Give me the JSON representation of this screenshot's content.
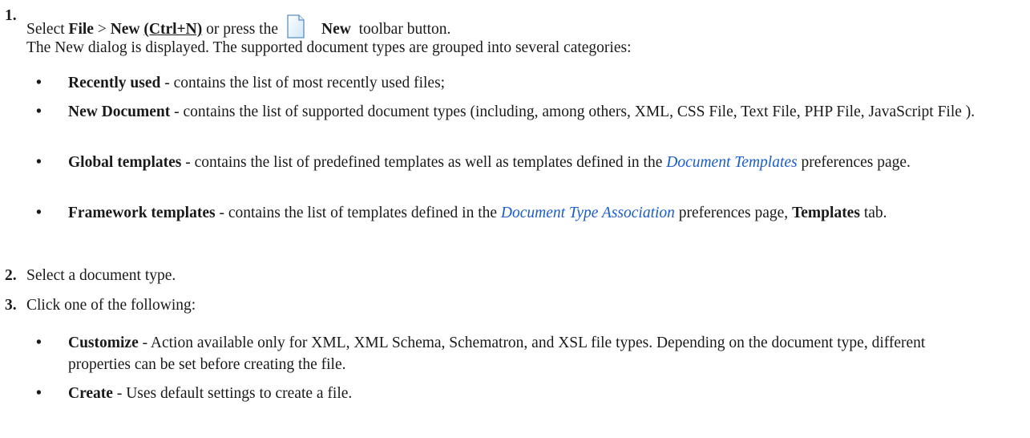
{
  "steps": [
    {
      "num": "1.",
      "intro": {
        "select": "Select ",
        "file": "File",
        "gt": " > ",
        "new": "New",
        "shortcut": "(Ctrl+N)",
        "or_press": " or press the",
        "new_button": "New",
        "toolbar": "  toolbar button."
      },
      "description": "The New dialog is displayed. The supported document types are grouped into several categories:",
      "bullets": [
        {
          "term": "Recently used",
          "text": " - contains the list of most recently used files;"
        },
        {
          "term": "New Document",
          "text": " - contains the list of supported document types (including, among others, XML, CSS File, Text File, PHP File, JavaScript File )."
        },
        {
          "term": "Global templates",
          "text": " - contains the list of predefined templates as well as templates defined in the ",
          "link": "Document Templates",
          "after": " preferences page."
        },
        {
          "term": "Framework templates",
          "text": " - contains the list of templates defined in the ",
          "link": "Document Type Association",
          "after": " preferences page, ",
          "term2": "Templates",
          "after2": " tab."
        }
      ]
    },
    {
      "num": "2.",
      "text": "Select a document type."
    },
    {
      "num": "3.",
      "text": "Click one of the following:",
      "bullets": [
        {
          "term": "Customize",
          "text": " - Action available only for XML, XML Schema, Schematron, and XSL file types. Depending on the document type, different properties can be set before creating the file."
        },
        {
          "term": "Create",
          "text": " - Uses default settings to create a file."
        }
      ]
    }
  ],
  "icons": {
    "new_document": "new-document-icon"
  },
  "colors": {
    "link": "#1a5ccc",
    "text": "#1a1a1a"
  }
}
